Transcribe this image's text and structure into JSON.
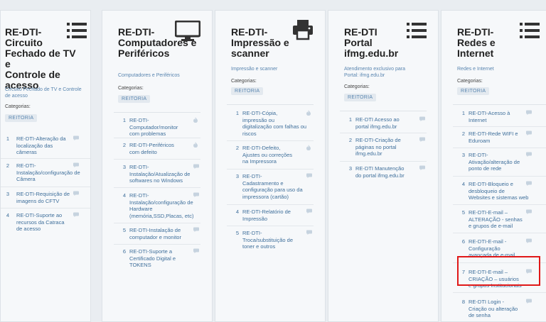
{
  "categories_label": "Categorias:",
  "category_badge": "REITORIA",
  "cards": [
    {
      "title": "RE-DTI-\nCircuito\nFechado de TV e\nControle de\nacesso",
      "icon": "list-icon",
      "description": "Circuito Fechado de TV e Controle\nde acesso",
      "items": [
        {
          "num": "1",
          "text": "RE-DTI-Alteração da\nlocalização das\ncâmeras",
          "icon": "comment-icon"
        },
        {
          "num": "2",
          "text": "RE-DTI-\nInstalação/configuração de\nCâmera",
          "icon": "comment-icon"
        },
        {
          "num": "3",
          "text": "RE-DTI-Requisição de\nimagens do CFTV",
          "icon": "comment-icon"
        },
        {
          "num": "4",
          "text": "RE-DTI-Suporte ao\nrecursos da Catraca\nde acesso",
          "icon": "comment-icon"
        }
      ]
    },
    {
      "title": "RE-DTI-\nComputadores e\nPeriféricos",
      "icon": "monitor-icon",
      "description": "Computadores e Periféricos",
      "items": [
        {
          "num": "1",
          "text": "RE-DTI-\nComputador/monitor\ncom problemas",
          "icon": "fire-icon"
        },
        {
          "num": "2",
          "text": "RE-DTI-Periféricos\ncom defeito",
          "icon": "fire-icon"
        },
        {
          "num": "3",
          "text": "RE-DTI-\nInstalação/Atualização de\nsoftwares no Windows",
          "icon": "comment-icon"
        },
        {
          "num": "4",
          "text": "RE-DTI-\nInstalação/configuração de\nHardware\n(memória,SSD,Placas, etc)",
          "icon": "comment-icon"
        },
        {
          "num": "5",
          "text": "RE-DTI-Instalação de\ncomputador e monitor",
          "icon": "comment-icon"
        },
        {
          "num": "6",
          "text": "RE-DTI-Suporte a\nCertificado Digital e\nTOKENS",
          "icon": "comment-icon"
        }
      ]
    },
    {
      "title": "RE-DTI-\nImpressão e\nscanner",
      "icon": "printer-icon",
      "description": "Impressão e scanner",
      "items": [
        {
          "num": "1",
          "text": "RE-DTI-Cópia,\nimpressão ou\ndigitalização com falhas ou\nriscos",
          "icon": "fire-icon"
        },
        {
          "num": "2",
          "text": "RE-DTI-Defeito,\nAjustes ou correções\nna Impressora",
          "icon": "fire-icon"
        },
        {
          "num": "3",
          "text": "RE-DTI-\nCadastramento e\nconfiguração para uso da\nimpressora (cartão)",
          "icon": "comment-icon"
        },
        {
          "num": "4",
          "text": "RE-DTI-Relatório de\nImpressão",
          "icon": "comment-icon"
        },
        {
          "num": "5",
          "text": "RE-DTI-\nTroca/substituição de\ntoner e outros",
          "icon": "comment-icon"
        }
      ]
    },
    {
      "title": "RE-DTI\nPortal\nifmg.edu.br",
      "icon": "list-icon",
      "description": "Atendimento exclusivo para\nPortal: ifmg.edu.br",
      "items": [
        {
          "num": "1",
          "text": "RE-DTI Acesso ao\nportal ifmg.edu.br",
          "icon": "comment-icon"
        },
        {
          "num": "2",
          "text": "RE-DTI-Criação de\npáginas no portal\nifmg.edu.br",
          "icon": "comment-icon"
        },
        {
          "num": "3",
          "text": "RE-DTI Manutenção\ndo portal ifmg.edu.br",
          "icon": "comment-icon"
        }
      ]
    },
    {
      "title": "RE-DTI-\nRedes e\nInternet",
      "icon": "list-icon",
      "description": "Redes e Internet",
      "items": [
        {
          "num": "1",
          "text": "RE-DTI-Acesso à\nInternet",
          "icon": "comment-icon"
        },
        {
          "num": "2",
          "text": "RE-DTI-Rede WIFI e\nEduroam",
          "icon": "comment-icon"
        },
        {
          "num": "3",
          "text": "RE-DTI-\nAtivação/alteração de\nponto de rede",
          "icon": "comment-icon"
        },
        {
          "num": "4",
          "text": "RE-DTI-Bloqueio e\ndesbloqueio de\nWebsites e sistemas web",
          "icon": "comment-icon"
        },
        {
          "num": "5",
          "text": "RE-DTI-E-mail –\nALTERAÇÃO - senhas\ne grupos de e-mail",
          "icon": "comment-icon"
        },
        {
          "num": "6",
          "text": "RE-DTI-E-mail -\nConfiguração\navançada de e-mail",
          "icon": "comment-icon"
        },
        {
          "num": "7",
          "text": "RE-DTI-E-mail –\nCRIAÇÃO – usuários\ne grupos Institucionais",
          "icon": "comment-icon"
        },
        {
          "num": "8",
          "text": "RE-DTI Login -\nCriação ou alteração\nde senha",
          "icon": "comment-icon"
        }
      ]
    }
  ]
}
